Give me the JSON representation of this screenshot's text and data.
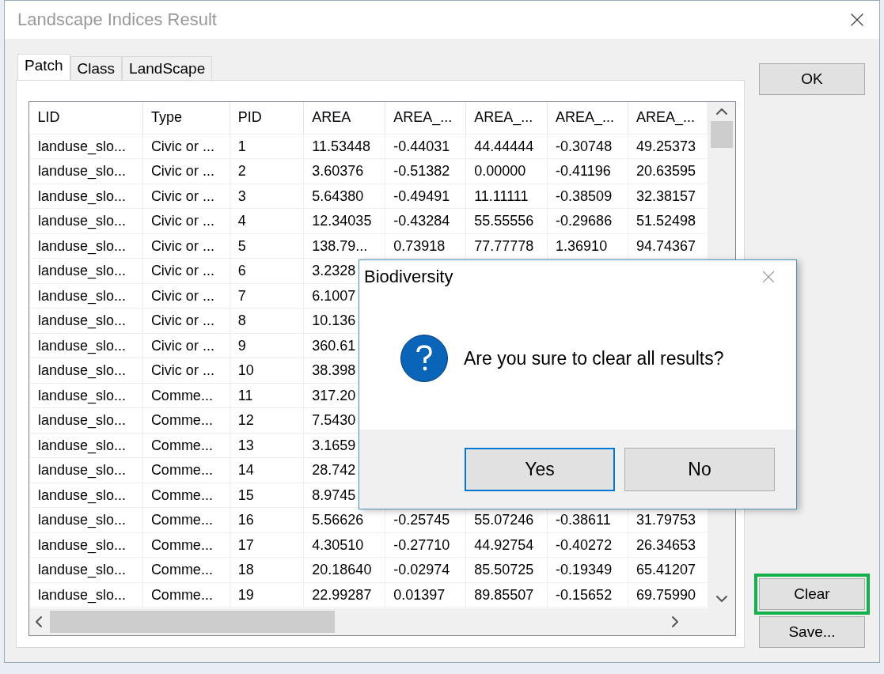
{
  "window": {
    "title": "Landscape Indices Result"
  },
  "tabs": [
    {
      "label": "Patch",
      "selected": true
    },
    {
      "label": "Class",
      "selected": false
    },
    {
      "label": "LandScape",
      "selected": false
    }
  ],
  "table": {
    "columns": [
      "LID",
      "Type",
      "PID",
      "AREA",
      "AREA_...",
      "AREA_...",
      "AREA_...",
      "AREA_..."
    ],
    "rows": [
      {
        "cells": [
          "landuse_slo...",
          "Civic or ...",
          "1",
          "11.53448",
          "-0.44031",
          "44.44444",
          "-0.30748",
          "49.25373"
        ]
      },
      {
        "cells": [
          "landuse_slo...",
          "Civic or ...",
          "2",
          "3.60376",
          "-0.51382",
          "0.00000",
          "-0.41196",
          "20.63595"
        ]
      },
      {
        "cells": [
          "landuse_slo...",
          "Civic or ...",
          "3",
          "5.64380",
          "-0.49491",
          "11.11111",
          "-0.38509",
          "32.38157"
        ]
      },
      {
        "cells": [
          "landuse_slo...",
          "Civic or ...",
          "4",
          "12.34035",
          "-0.43284",
          "55.55556",
          "-0.29686",
          "51.52498"
        ]
      },
      {
        "cells": [
          "landuse_slo...",
          "Civic or ...",
          "5",
          "138.79...",
          "0.73918",
          "77.77778",
          "1.36910",
          "94.74367"
        ]
      },
      {
        "cells": [
          "landuse_slo...",
          "Civic or ...",
          "6",
          "3.2328"
        ]
      },
      {
        "cells": [
          "landuse_slo...",
          "Civic or ...",
          "7",
          "6.1007"
        ]
      },
      {
        "cells": [
          "landuse_slo...",
          "Civic or ...",
          "8",
          "10.136"
        ]
      },
      {
        "cells": [
          "landuse_slo...",
          "Civic or ...",
          "9",
          "360.61"
        ]
      },
      {
        "cells": [
          "landuse_slo...",
          "Civic or ...",
          "10",
          "38.398"
        ]
      },
      {
        "cells": [
          "landuse_slo...",
          "Comme...",
          "11",
          "317.20"
        ]
      },
      {
        "cells": [
          "landuse_slo...",
          "Comme...",
          "12",
          "7.5430"
        ]
      },
      {
        "cells": [
          "landuse_slo...",
          "Comme...",
          "13",
          "3.1659"
        ]
      },
      {
        "cells": [
          "landuse_slo...",
          "Comme...",
          "14",
          "28.742"
        ]
      },
      {
        "cells": [
          "landuse_slo...",
          "Comme...",
          "15",
          "8.9745"
        ]
      },
      {
        "cells": [
          "landuse_slo...",
          "Comme...",
          "16",
          "5.56626",
          "-0.25745",
          "55.07246",
          "-0.38611",
          "31.79753"
        ]
      },
      {
        "cells": [
          "landuse_slo...",
          "Comme...",
          "17",
          "4.30510",
          "-0.27710",
          "44.92754",
          "-0.40272",
          "26.34653"
        ]
      },
      {
        "cells": [
          "landuse_slo...",
          "Comme...",
          "18",
          "20.18640",
          "-0.02974",
          "85.50725",
          "-0.19349",
          "65.41207"
        ]
      },
      {
        "cells": [
          "landuse_slo...",
          "Comme...",
          "19",
          "22.99287",
          "0.01397",
          "89.85507",
          "-0.15652",
          "69.75990"
        ]
      }
    ]
  },
  "buttons": [
    {
      "label": "OK",
      "kind": "ok"
    },
    {
      "label": "Clear",
      "kind": "highlighted"
    },
    {
      "label": "Save...",
      "kind": "save"
    }
  ],
  "dialog": {
    "title": "Biodiversity",
    "message": "Are you sure to clear all results?",
    "buttons": [
      {
        "label": "Yes",
        "selected": true
      },
      {
        "label": "No",
        "selected": false
      }
    ]
  }
}
